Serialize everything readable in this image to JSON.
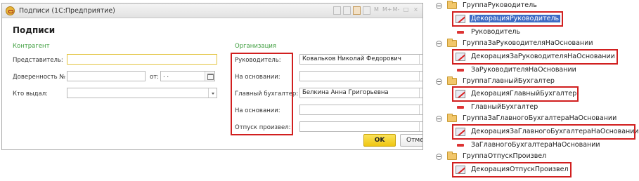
{
  "window": {
    "title": "Подписи  (1С:Предприятие)",
    "toolbar_icons": [
      "doc-icon",
      "copy-icon",
      "calendar-icon",
      "list-icon"
    ],
    "toolbar_glyphs": {
      "m": "M",
      "mplus": "M+",
      "mminus": "M-",
      "restore": "□",
      "close": "×"
    }
  },
  "form": {
    "title": "Подписи",
    "kontragent": {
      "section": "Контрагент",
      "representative_label": "Представитель:",
      "representative_value": "",
      "power_label": "Доверенность №",
      "power_value": "",
      "from_label": "от:",
      "date_value": "  .  .",
      "issued_label": "Кто выдал:",
      "issued_value": ""
    },
    "organization": {
      "section": "Организация",
      "rows": [
        {
          "label": "Руководитель:",
          "value": "Ковальков  Николай Федорович"
        },
        {
          "label": "На основании:",
          "value": ""
        },
        {
          "label": "Главный бухгалтер:",
          "value": "Белкина Анна  Григорьевна"
        },
        {
          "label": "На основании:",
          "value": ""
        },
        {
          "label": "Отпуск произвел:",
          "value": ""
        }
      ]
    },
    "buttons": {
      "ok": "OK",
      "cancel": "Отмена"
    }
  },
  "tree": [
    {
      "group": "ГруппаРуководитель",
      "decoration": "ДекорацияРуководитель",
      "field": "Руководитель",
      "selected": true
    },
    {
      "group": "ГруппаЗаРуководителяНаОсновании",
      "decoration": "ДекорацияЗаРуководителяНаОсновании",
      "field": "ЗаРуководителяНаОсновании",
      "selected": false
    },
    {
      "group": "ГруппаГлавныйБухгалтер",
      "decoration": "ДекорацияГлавныйБухгалтер",
      "field": "ГлавныйБухгалтер",
      "selected": false
    },
    {
      "group": "ГруппаЗаГлавногоБухгалтераНаОсновании",
      "decoration": "ДекорацияЗаГлавногоБухгалтераНаОсновании",
      "field": "ЗаГлавногоБухгалтераНаОсновании",
      "selected": false
    },
    {
      "group": "ГруппаОтпускПроизвел",
      "decoration": "ДекорацияОтпускПроизвел",
      "field": "",
      "selected": false
    }
  ],
  "colors": {
    "highlight_border": "#d11f1f",
    "selection": "#3d6bc4",
    "section_green": "#3c9d3c",
    "ok_button": "#f5d22c"
  }
}
